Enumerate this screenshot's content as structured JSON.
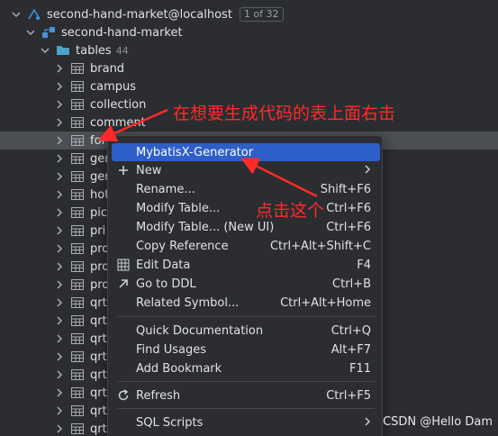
{
  "datasource": {
    "name": "second-hand-market@localhost",
    "badge": "1 of 32"
  },
  "schema": {
    "name": "second-hand-market"
  },
  "tables_folder": {
    "label": "tables",
    "count": "44"
  },
  "tables": [
    {
      "name": "brand"
    },
    {
      "name": "campus"
    },
    {
      "name": "collection"
    },
    {
      "name": "comment"
    },
    {
      "name": "fol"
    },
    {
      "name": "ger"
    },
    {
      "name": "ger"
    },
    {
      "name": "hot"
    },
    {
      "name": "pic"
    },
    {
      "name": "pri"
    },
    {
      "name": "pro"
    },
    {
      "name": "pro"
    },
    {
      "name": "pro"
    },
    {
      "name": "qrt"
    },
    {
      "name": "qrt"
    },
    {
      "name": "qrt"
    },
    {
      "name": "qrt"
    },
    {
      "name": "qrt"
    },
    {
      "name": "qrt"
    },
    {
      "name": "qrt"
    },
    {
      "name": "qrt"
    }
  ],
  "menu": {
    "mybatisx": {
      "label": "MybatisX-Generator"
    },
    "new": {
      "label": "New"
    },
    "rename": {
      "label": "Rename...",
      "shortcut": "Shift+F6"
    },
    "modify_table": {
      "label": "Modify Table...",
      "shortcut": "Ctrl+F6"
    },
    "modify_table_new": {
      "label": "Modify Table... (New UI)",
      "shortcut": "Ctrl+F6"
    },
    "copy_reference": {
      "label": "Copy Reference",
      "shortcut": "Ctrl+Alt+Shift+C"
    },
    "edit_data": {
      "label": "Edit Data",
      "shortcut": "F4"
    },
    "go_to_ddl": {
      "label": "Go to DDL",
      "shortcut": "Ctrl+B"
    },
    "related_symbol": {
      "label": "Related Symbol...",
      "shortcut": "Ctrl+Alt+Home"
    },
    "quick_doc": {
      "label": "Quick Documentation",
      "shortcut": "Ctrl+Q"
    },
    "find_usages": {
      "label": "Find Usages",
      "shortcut": "Alt+F7"
    },
    "add_bookmark": {
      "label": "Add Bookmark",
      "shortcut": "F11"
    },
    "refresh": {
      "label": "Refresh",
      "shortcut": "Ctrl+F5"
    },
    "sql_scripts": {
      "label": "SQL Scripts"
    }
  },
  "annotations": {
    "right_click_note": "在想要生成代码的表上面右击",
    "click_note": "点击这个"
  },
  "watermark": "CSDN @Hello Dam",
  "colors": {
    "menu_highlight": "#2e5ec7",
    "annotation_red": "#ff2a2a",
    "selected_row": "#4b4e53"
  }
}
